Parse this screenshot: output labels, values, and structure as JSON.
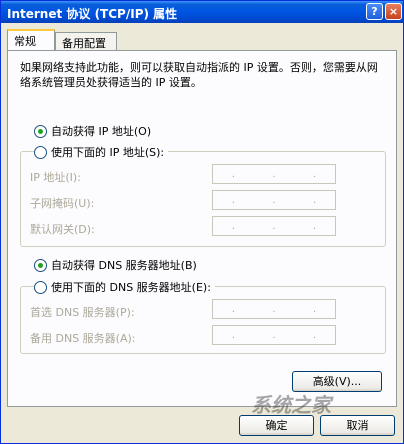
{
  "window": {
    "title": "Internet 协议 (TCP/IP) 属性",
    "help_glyph": "?",
    "close_glyph": "×"
  },
  "tabs": [
    {
      "label": "常规"
    },
    {
      "label": "备用配置"
    }
  ],
  "description": "如果网络支持此功能，则可以获取自动指派的 IP 设置。否则，您需要从网络系统管理员处获得适当的 IP 设置。",
  "ip_section": {
    "auto_label": "自动获得 IP 地址(O)",
    "manual_label": "使用下面的 IP 地址(S):",
    "fields": [
      {
        "label": "IP 地址(I):"
      },
      {
        "label": "子网掩码(U):"
      },
      {
        "label": "默认网关(D):"
      }
    ]
  },
  "dns_section": {
    "auto_label": "自动获得 DNS 服务器地址(B)",
    "manual_label": "使用下面的 DNS 服务器地址(E):",
    "fields": [
      {
        "label": "首选 DNS 服务器(P):"
      },
      {
        "label": "备用 DNS 服务器(A):"
      }
    ]
  },
  "ip_dot": ".",
  "buttons": {
    "advanced": "高级(V)...",
    "ok": "确定",
    "cancel": "取消"
  },
  "watermark": "系统之家",
  "colors": {
    "titlebar": "#0054e3",
    "face": "#ece9d8",
    "tab_highlight": "#ffc83c",
    "radio_dot": "#21a121"
  }
}
